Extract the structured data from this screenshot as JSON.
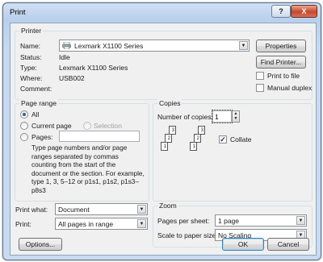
{
  "window": {
    "title": "Print",
    "help_label": "?",
    "close_label": "X"
  },
  "printer": {
    "group_label": "Printer",
    "name_label": "Name:",
    "name_value": "Lexmark X1100 Series",
    "status_label": "Status:",
    "status_value": "Idle",
    "type_label": "Type:",
    "type_value": "Lexmark X1100 Series",
    "where_label": "Where:",
    "where_value": "USB002",
    "comment_label": "Comment:",
    "comment_value": "",
    "properties_label": "Properties",
    "find_printer_label": "Find Printer...",
    "print_to_file_label": "Print to file",
    "print_to_file_checked": false,
    "manual_duplex_label": "Manual duplex",
    "manual_duplex_checked": false
  },
  "page_range": {
    "group_label": "Page range",
    "all_label": "All",
    "current_page_label": "Current page",
    "selection_label": "Selection",
    "pages_label": "Pages:",
    "pages_value": "",
    "selected": "all",
    "help_text": "Type page numbers and/or page ranges separated by commas counting from the start of the document or the section. For example, type 1, 3, 5–12 or p1s1, p1s2, p1s3–p8s3"
  },
  "copies": {
    "group_label": "Copies",
    "number_label": "Number of copies:",
    "number_value": "1",
    "collate_label": "Collate",
    "collate_checked": true,
    "stack_pages": [
      "3",
      "2",
      "1"
    ]
  },
  "print_what": {
    "label": "Print what:",
    "value": "Document"
  },
  "print": {
    "label": "Print:",
    "value": "All pages in range"
  },
  "zoom": {
    "group_label": "Zoom",
    "pages_per_sheet_label": "Pages per sheet:",
    "pages_per_sheet_value": "1 page",
    "scale_label": "Scale to paper size:",
    "scale_value": "No Scaling"
  },
  "buttons": {
    "options": "Options...",
    "ok": "OK",
    "cancel": "Cancel"
  },
  "colors": {
    "accent": "#3c7fb1",
    "title_bar": "#c8dbf1",
    "panel": "#f0f0f0"
  },
  "icons": {
    "printer": "printer-icon",
    "dropdown": "chevron-down-icon"
  }
}
